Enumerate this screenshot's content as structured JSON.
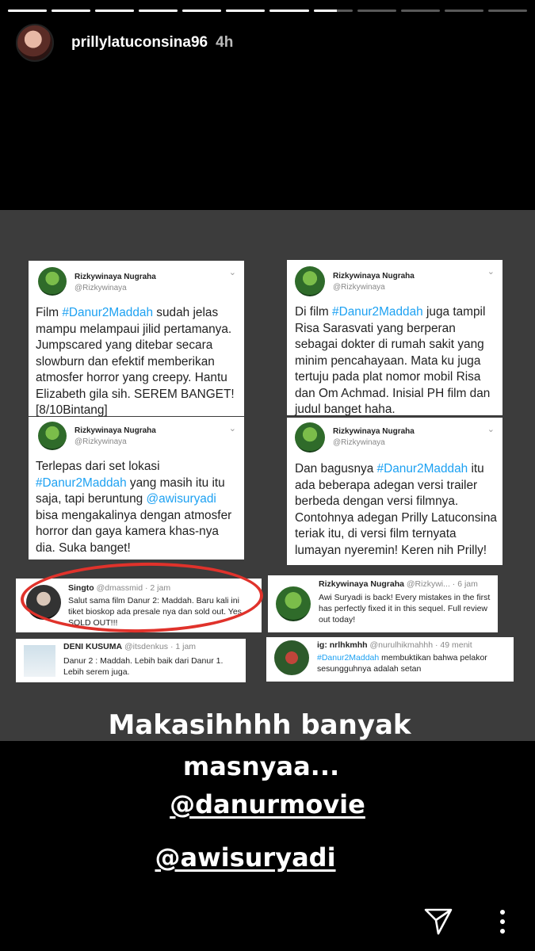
{
  "story": {
    "segments": [
      1,
      1,
      1,
      1,
      1,
      1,
      1,
      0.6,
      0,
      0,
      0,
      0
    ],
    "username": "prillylatuconsina96",
    "time": "4h"
  },
  "tweets_large": [
    {
      "name": "Rizkywinaya Nugraha",
      "handle": "@Rizkywinaya",
      "pre": "Film ",
      "tag": "#Danur2Maddah",
      "post": " sudah jelas mampu melampaui jilid pertamanya. Jumpscared yang ditebar secara slowburn dan efektif memberikan atmosfer horror yang creepy. Hantu Elizabeth gila sih. SEREM BANGET! [8/10Bintang]"
    },
    {
      "name": "Rizkywinaya Nugraha",
      "handle": "@Rizkywinaya",
      "pre": "Di film ",
      "tag": "#Danur2Maddah",
      "post": " juga tampil Risa Sarasvati yang berperan sebagai dokter di rumah sakit yang minim pencahayaan. Mata ku juga tertuju pada plat nomor mobil Risa dan Om Achmad. Inisial PH film dan judul banget haha."
    },
    {
      "name": "Rizkywinaya Nugraha",
      "handle": "@Rizkywinaya",
      "pre": "Terlepas dari set lokasi ",
      "tag": "#Danur2Maddah",
      "mid": " yang masih itu itu saja, tapi beruntung ",
      "tag2": "@awisuryadi",
      "post": " bisa mengakalinya dengan atmosfer horror dan gaya kamera khas-nya dia. Suka banget!"
    },
    {
      "name": "Rizkywinaya Nugraha",
      "handle": "@Rizkywinaya",
      "pre": "Dan bagusnya ",
      "tag": "#Danur2Maddah",
      "post": " itu ada beberapa adegan versi trailer berbeda dengan versi filmnya. Contohnya adegan Prilly Latuconsina teriak itu, di versi film ternyata lumayan nyeremin! Keren nih Prilly!"
    }
  ],
  "tweets_small": [
    {
      "name": "Singto",
      "handle": "@dmassmid · 2 jam",
      "text": "Salut sama film Danur 2: Maddah. Baru kali ini tiket bioskop ada presale nya dan sold out. Yes, SOLD OUT!!!"
    },
    {
      "name": "Rizkywinaya Nugraha",
      "handle": "@Rizkywi... · 6 jam",
      "text": "Awi Suryadi is back! Every mistakes in the first has perfectly fixed it in this sequel. Full review out today!"
    },
    {
      "name": "DENI KUSUMA",
      "handle": "@itsdenkus · 1 jam",
      "text": "Danur 2 : Maddah. Lebih baik dari Danur 1. Lebih serem juga."
    },
    {
      "name": "ig: nrlhkmhh",
      "handle": "@nurulhikmahhh · 49 menit",
      "tag": "#Danur2Maddah",
      "text": " membuktikan bahwa pelakor sesungguhnya adalah setan⁣"
    }
  ],
  "caption": {
    "line1": "Makasihhhh banyak",
    "line2": "masnyaa...",
    "mention1": "@danurmovie",
    "mention2": "@awisuryadi"
  },
  "colors": {
    "hashtag": "#1da1f2",
    "highlight_circle": "#e0322b",
    "panel": "#3c3c3c"
  },
  "icons": [
    "send-icon",
    "more-options-icon"
  ]
}
